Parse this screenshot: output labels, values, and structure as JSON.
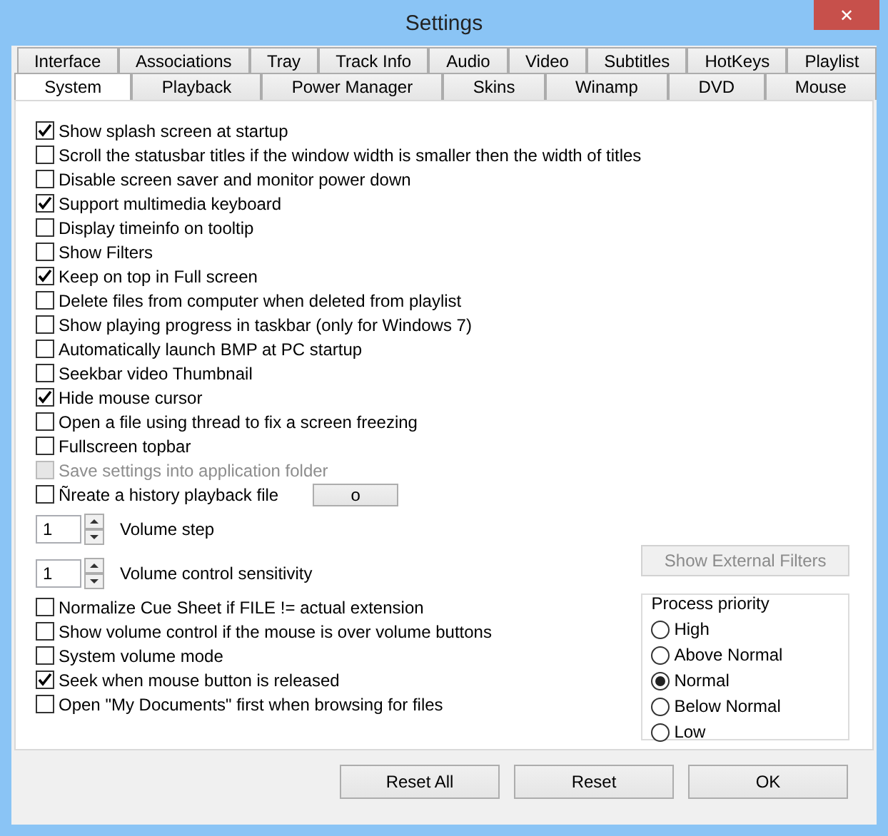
{
  "window": {
    "title": "Settings",
    "close": "✕"
  },
  "tab_rows": [
    {
      "tabs": [
        {
          "label": "Interface",
          "selected": false
        },
        {
          "label": "Associations",
          "selected": false
        },
        {
          "label": "Tray",
          "selected": false
        },
        {
          "label": "Track Info",
          "selected": false
        },
        {
          "label": "Audio",
          "selected": false
        },
        {
          "label": "Video",
          "selected": false
        },
        {
          "label": "Subtitles",
          "selected": false
        },
        {
          "label": "HotKeys",
          "selected": false
        },
        {
          "label": "Playlist",
          "selected": false
        }
      ]
    },
    {
      "tabs": [
        {
          "label": "System",
          "selected": true
        },
        {
          "label": "Playback",
          "selected": false
        },
        {
          "label": "Power Manager",
          "selected": false
        },
        {
          "label": "Skins",
          "selected": false
        },
        {
          "label": "Winamp",
          "selected": false
        },
        {
          "label": "DVD",
          "selected": false
        },
        {
          "label": "Mouse",
          "selected": false
        }
      ]
    }
  ],
  "options": [
    {
      "kind": "checkbox",
      "label": "Show splash screen at startup",
      "checked": true,
      "disabled": false
    },
    {
      "kind": "checkbox",
      "label": "Scroll the statusbar titles if the window width is smaller then the width of titles",
      "checked": false,
      "disabled": false
    },
    {
      "kind": "checkbox",
      "label": "Disable screen saver and monitor power down",
      "checked": false,
      "disabled": false
    },
    {
      "kind": "checkbox",
      "label": "Support multimedia keyboard",
      "checked": true,
      "disabled": false
    },
    {
      "kind": "checkbox",
      "label": "Display timeinfo on tooltip",
      "checked": false,
      "disabled": false
    },
    {
      "kind": "checkbox",
      "label": "Show Filters",
      "checked": false,
      "disabled": false
    },
    {
      "kind": "checkbox",
      "label": "Keep on top in Full screen",
      "checked": true,
      "disabled": false
    },
    {
      "kind": "checkbox",
      "label": "Delete files from computer when deleted from playlist",
      "checked": false,
      "disabled": false
    },
    {
      "kind": "checkbox",
      "label": "Show playing progress in taskbar (only for Windows 7)",
      "checked": false,
      "disabled": false
    },
    {
      "kind": "checkbox",
      "label": "Automatically launch BMP at PC startup",
      "checked": false,
      "disabled": false
    },
    {
      "kind": "checkbox",
      "label": "Seekbar video Thumbnail",
      "checked": false,
      "disabled": false
    },
    {
      "kind": "checkbox",
      "label": "Hide mouse cursor",
      "checked": true,
      "disabled": false
    },
    {
      "kind": "checkbox",
      "label": "Open a file using thread to fix a screen freezing",
      "checked": false,
      "disabled": false
    },
    {
      "kind": "checkbox",
      "label": "Fullscreen topbar",
      "checked": false,
      "disabled": false
    },
    {
      "kind": "checkbox",
      "label": "Save settings into application folder",
      "checked": false,
      "disabled": true
    },
    {
      "kind": "checkbox",
      "label": "Ñreate a history playback file",
      "checked": false,
      "disabled": false,
      "button": "o"
    },
    {
      "kind": "spinner",
      "value": "1",
      "caption": "Volume step"
    },
    {
      "kind": "spinner",
      "value": "1",
      "caption": "Volume control sensitivity"
    },
    {
      "kind": "checkbox",
      "label": "Normalize Cue Sheet if FILE != actual extension",
      "checked": false,
      "disabled": false
    },
    {
      "kind": "checkbox",
      "label": "Show volume control if the mouse is over volume buttons",
      "checked": false,
      "disabled": false
    },
    {
      "kind": "checkbox",
      "label": "System volume mode",
      "checked": false,
      "disabled": false
    },
    {
      "kind": "checkbox",
      "label": "Seek when mouse button is released",
      "checked": true,
      "disabled": false
    },
    {
      "kind": "checkbox",
      "label": "Open \"My Documents\" first when browsing for files",
      "checked": false,
      "disabled": false
    }
  ],
  "external_filters_button": {
    "label": "Show External Filters",
    "disabled": true
  },
  "process_priority": {
    "title": "Process priority",
    "options": [
      {
        "label": "High",
        "selected": false
      },
      {
        "label": "Above Normal",
        "selected": false
      },
      {
        "label": "Normal",
        "selected": true
      },
      {
        "label": "Below Normal",
        "selected": false
      },
      {
        "label": "Low",
        "selected": false
      }
    ]
  },
  "buttons": [
    "Reset All",
    "Reset",
    "OK"
  ]
}
